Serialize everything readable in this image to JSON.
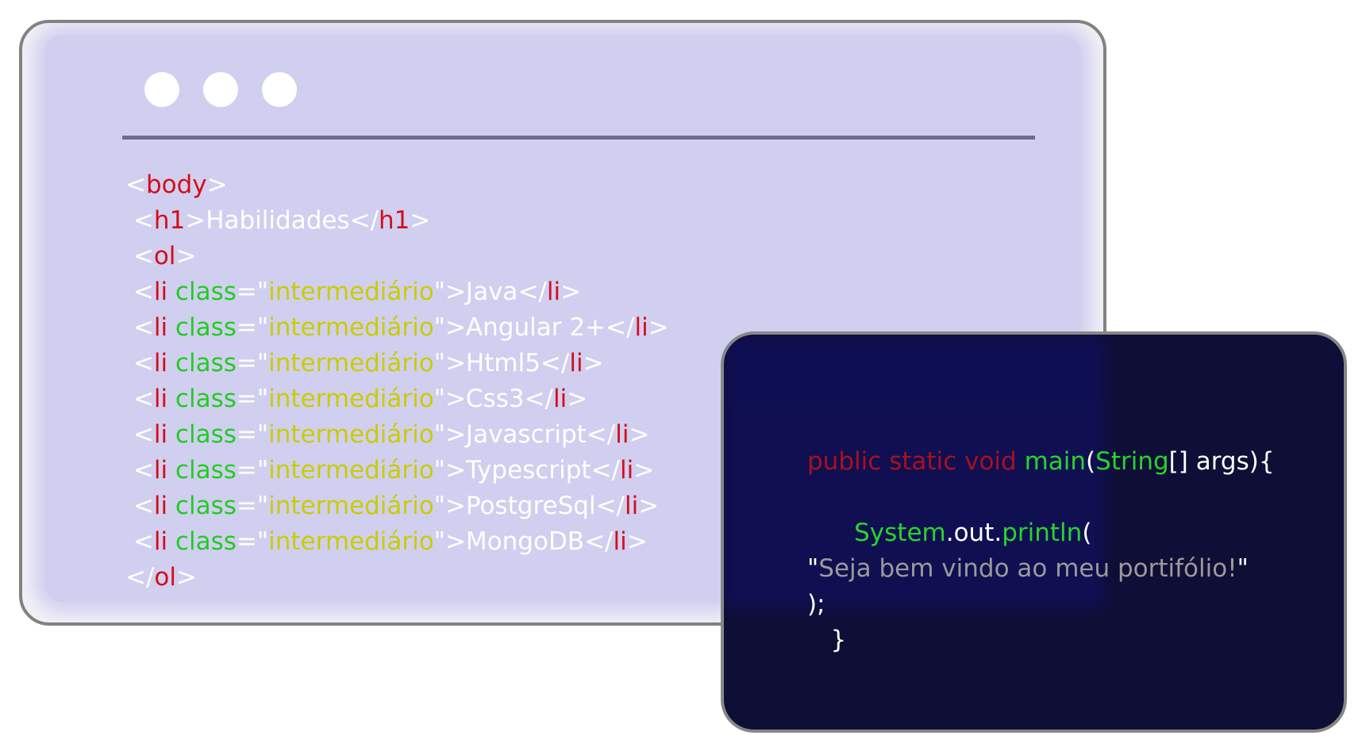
{
  "colors": {
    "tag_red": "#d40d1a",
    "attr_green": "#22cc22",
    "string_yellow": "#c9cc00",
    "bracket_white": "#ffffff",
    "java_keyword_red": "#a8101d",
    "java_type_green": "#28d42b",
    "java_string_gray": "#9a9a9a"
  },
  "html_window": {
    "lines": [
      [
        {
          "t": "<",
          "c": "white"
        },
        {
          "t": "body",
          "c": "red"
        },
        {
          "t": ">",
          "c": "white"
        }
      ],
      [
        {
          "t": " <",
          "c": "white"
        },
        {
          "t": "h1",
          "c": "red"
        },
        {
          "t": ">Habilidades</",
          "c": "white"
        },
        {
          "t": "h1",
          "c": "red"
        },
        {
          "t": ">",
          "c": "white"
        }
      ],
      [
        {
          "t": " <",
          "c": "white"
        },
        {
          "t": "ol",
          "c": "red"
        },
        {
          "t": ">",
          "c": "white"
        }
      ],
      [
        {
          "t": " <",
          "c": "white"
        },
        {
          "t": "li",
          "c": "red"
        },
        {
          "t": " class",
          "c": "green"
        },
        {
          "t": "=\"",
          "c": "white"
        },
        {
          "t": "intermediário",
          "c": "yellow"
        },
        {
          "t": "\">Java</",
          "c": "white"
        },
        {
          "t": "li",
          "c": "red"
        },
        {
          "t": ">",
          "c": "white"
        }
      ],
      [
        {
          "t": " <",
          "c": "white"
        },
        {
          "t": "li",
          "c": "red"
        },
        {
          "t": " class",
          "c": "green"
        },
        {
          "t": "=\"",
          "c": "white"
        },
        {
          "t": "intermediário",
          "c": "yellow"
        },
        {
          "t": "\">Angular 2+</",
          "c": "white"
        },
        {
          "t": "li",
          "c": "red"
        },
        {
          "t": ">",
          "c": "white"
        }
      ],
      [
        {
          "t": " <",
          "c": "white"
        },
        {
          "t": "li",
          "c": "red"
        },
        {
          "t": " class",
          "c": "green"
        },
        {
          "t": "=\"",
          "c": "white"
        },
        {
          "t": "intermediário",
          "c": "yellow"
        },
        {
          "t": "\">Html5</",
          "c": "white"
        },
        {
          "t": "li",
          "c": "red"
        },
        {
          "t": ">",
          "c": "white"
        }
      ],
      [
        {
          "t": " <",
          "c": "white"
        },
        {
          "t": "li",
          "c": "red"
        },
        {
          "t": " class",
          "c": "green"
        },
        {
          "t": "=\"",
          "c": "white"
        },
        {
          "t": "intermediário",
          "c": "yellow"
        },
        {
          "t": "\">Css3</",
          "c": "white"
        },
        {
          "t": "li",
          "c": "red"
        },
        {
          "t": ">",
          "c": "white"
        }
      ],
      [
        {
          "t": " <",
          "c": "white"
        },
        {
          "t": "li",
          "c": "red"
        },
        {
          "t": " class",
          "c": "green"
        },
        {
          "t": "=\"",
          "c": "white"
        },
        {
          "t": "intermediário",
          "c": "yellow"
        },
        {
          "t": "\">Javascript</",
          "c": "white"
        },
        {
          "t": "li",
          "c": "red"
        },
        {
          "t": ">",
          "c": "white"
        }
      ],
      [
        {
          "t": " <",
          "c": "white"
        },
        {
          "t": "li",
          "c": "red"
        },
        {
          "t": " class",
          "c": "green"
        },
        {
          "t": "=\"",
          "c": "white"
        },
        {
          "t": "intermediário",
          "c": "yellow"
        },
        {
          "t": "\">Typescript</",
          "c": "white"
        },
        {
          "t": "li",
          "c": "red"
        },
        {
          "t": ">",
          "c": "white"
        }
      ],
      [
        {
          "t": " <",
          "c": "white"
        },
        {
          "t": "li",
          "c": "red"
        },
        {
          "t": " class",
          "c": "green"
        },
        {
          "t": "=\"",
          "c": "white"
        },
        {
          "t": "intermediário",
          "c": "yellow"
        },
        {
          "t": "\">PostgreSql</",
          "c": "white"
        },
        {
          "t": "li",
          "c": "red"
        },
        {
          "t": ">",
          "c": "white"
        }
      ],
      [
        {
          "t": " <",
          "c": "white"
        },
        {
          "t": "li",
          "c": "red"
        },
        {
          "t": " class",
          "c": "green"
        },
        {
          "t": "=\"",
          "c": "white"
        },
        {
          "t": "intermediário",
          "c": "yellow"
        },
        {
          "t": "\">MongoDB</",
          "c": "white"
        },
        {
          "t": "li",
          "c": "red"
        },
        {
          "t": ">",
          "c": "white"
        }
      ],
      [
        {
          "t": "</",
          "c": "white"
        },
        {
          "t": "ol",
          "c": "red"
        },
        {
          "t": ">",
          "c": "white"
        }
      ]
    ]
  },
  "java_window": {
    "lines": [
      [
        {
          "t": "public static void ",
          "c": "jred"
        },
        {
          "t": "main",
          "c": "jgreen"
        },
        {
          "t": "(",
          "c": "white"
        },
        {
          "t": "String",
          "c": "jgreen"
        },
        {
          "t": "[] args){",
          "c": "white"
        }
      ],
      [],
      [
        {
          "t": "      ",
          "c": "white"
        },
        {
          "t": "System",
          "c": "jgreen"
        },
        {
          "t": ".out.",
          "c": "white"
        },
        {
          "t": "println",
          "c": "jgreen"
        },
        {
          "t": "(",
          "c": "white"
        }
      ],
      [
        {
          "t": "\"",
          "c": "white"
        },
        {
          "t": "Seja bem vindo ao meu portifólio!",
          "c": "gray"
        },
        {
          "t": "\"",
          "c": "white"
        }
      ],
      [
        {
          "t": ");",
          "c": "white"
        }
      ],
      [
        {
          "t": "   }",
          "c": "white"
        }
      ]
    ]
  }
}
